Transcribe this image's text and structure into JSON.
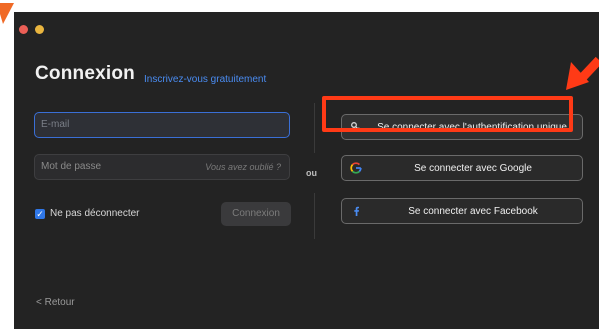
{
  "login": {
    "title": "Connexion",
    "signup_link": "Inscrivez-vous gratuitement",
    "email_placeholder": "E-mail",
    "password_placeholder": "Mot de passe",
    "forgot_link": "Vous avez oublié ?",
    "remember_label": "Ne pas déconnecter",
    "remember_checked": true,
    "login_button": "Connexion",
    "or_label": "ou",
    "back_link": "Retour"
  },
  "providers": [
    {
      "id": "sso",
      "label": "Se connecter avec l'authentification unique",
      "icon": "key-icon"
    },
    {
      "id": "google",
      "label": "Se connecter avec Google",
      "icon": "google-icon"
    },
    {
      "id": "facebook",
      "label": "Se connecter avec Facebook",
      "icon": "facebook-icon"
    }
  ],
  "colors": {
    "accent": "#4a8cf2",
    "highlight": "#ff3a16",
    "window_bg": "#232323"
  }
}
